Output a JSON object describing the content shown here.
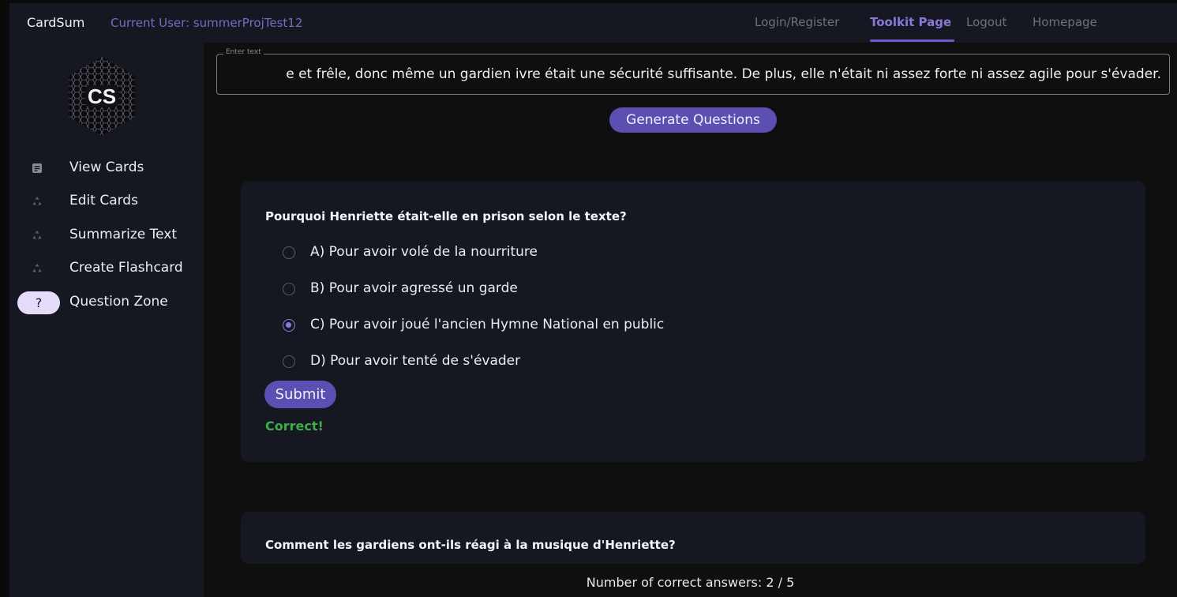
{
  "header": {
    "brand": "CardSum",
    "current_user": "Current User: summerProjTest12",
    "nav": [
      "Login/Register",
      "Toolkit Page",
      "Logout",
      "Homepage"
    ],
    "active_nav": "Toolkit Page"
  },
  "logo": {
    "text": "CS"
  },
  "sidebar": {
    "items": [
      {
        "label": "View Cards",
        "icon": "note-icon"
      },
      {
        "label": "Edit Cards",
        "icon": "recycle-icon"
      },
      {
        "label": "Summarize Text",
        "icon": "recycle-icon"
      },
      {
        "label": "Create Flashcard",
        "icon": "recycle-icon"
      },
      {
        "label": "Question Zone",
        "icon": "question-icon",
        "icon_text": "?"
      }
    ]
  },
  "input": {
    "label": "Enter text",
    "value": "e et frêle, donc même un gardien ivre était une sécurité suffisante. De plus, elle n'était ni assez forte ni assez agile pour s'évader."
  },
  "generate_button": "Generate Questions",
  "questions": [
    {
      "question": "Pourquoi Henriette était-elle en prison selon le texte?",
      "options": [
        "A) Pour avoir volé de la nourriture",
        "B) Pour avoir agressé un garde",
        "C) Pour avoir joué l'ancien Hymne National en public",
        "D) Pour avoir tenté de s'évader"
      ],
      "selected": "C) Pour avoir joué l'ancien Hymne National en public",
      "submit": "Submit",
      "result": "Correct!"
    },
    {
      "question": "Comment les gardiens ont-ils réagi à la musique d'Henriette?"
    }
  ],
  "score": "Number of correct answers: 2 / 5",
  "colors": {
    "accent": "#5b4fb2",
    "active_nav": "#8a78d8",
    "correct": "#3fae49",
    "panel": "#161821"
  }
}
